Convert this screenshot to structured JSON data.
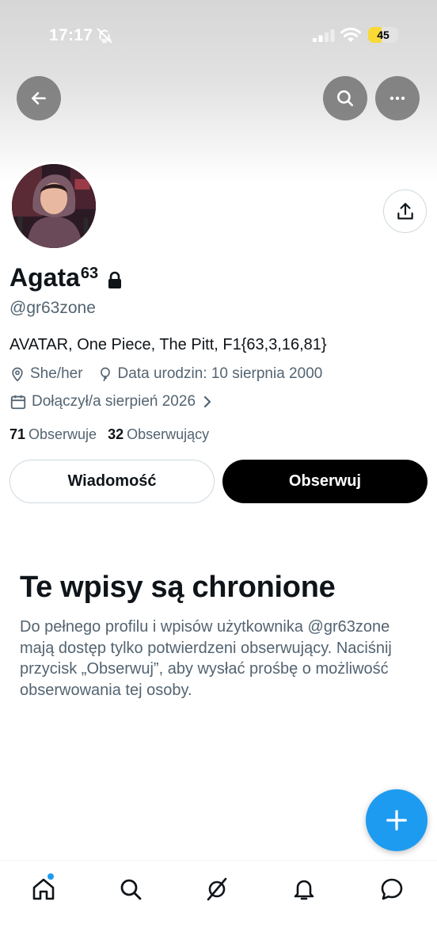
{
  "status_bar": {
    "time": "17:17",
    "battery": "45",
    "battery_level": 0.45
  },
  "icons": {
    "back": "arrow-left-icon",
    "search": "search-icon",
    "more": "more-horizontal-icon",
    "share": "share-upload-icon",
    "lock": "lock-icon",
    "location": "location-pin-icon",
    "birthday": "balloon-icon",
    "joined": "calendar-icon",
    "compose": "plus-icon"
  },
  "profile": {
    "name": "Agata",
    "name_sup": "63",
    "handle": "@gr63zone",
    "bio": "AVATAR, One Piece, The Pitt, F1{63,3,16,81}",
    "pronouns": "She/her",
    "birthday": "Data urodzin: 10 sierpnia 2000",
    "joined": "Dołączył/a sierpień 2026",
    "following_count": "71",
    "following_label": "Obserwuje",
    "followers_count": "32",
    "followers_label": "Obserwujący"
  },
  "actions": {
    "message": "Wiadomość",
    "follow": "Obserwuj"
  },
  "protected": {
    "title": "Te wpisy są chronione",
    "text": "Do pełnego profilu i wpisów użytkownika @gr63zone mają dostęp tylko potwierdzeni obserwujący. Naciśnij przycisk „Obserwuj”, aby wysłać prośbę o możliwość obserwowania tej osoby."
  },
  "bottom_nav": [
    {
      "name": "home",
      "icon": "home-icon",
      "active": true
    },
    {
      "name": "search",
      "icon": "search-icon"
    },
    {
      "name": "grok",
      "icon": "grok-icon"
    },
    {
      "name": "notifications",
      "icon": "bell-icon"
    },
    {
      "name": "messages",
      "icon": "chat-bubble-icon"
    }
  ],
  "colors": {
    "accent": "#1d9bf0",
    "text_primary": "#0f1419",
    "text_secondary": "#536471",
    "battery_fill": "#f8d936"
  }
}
